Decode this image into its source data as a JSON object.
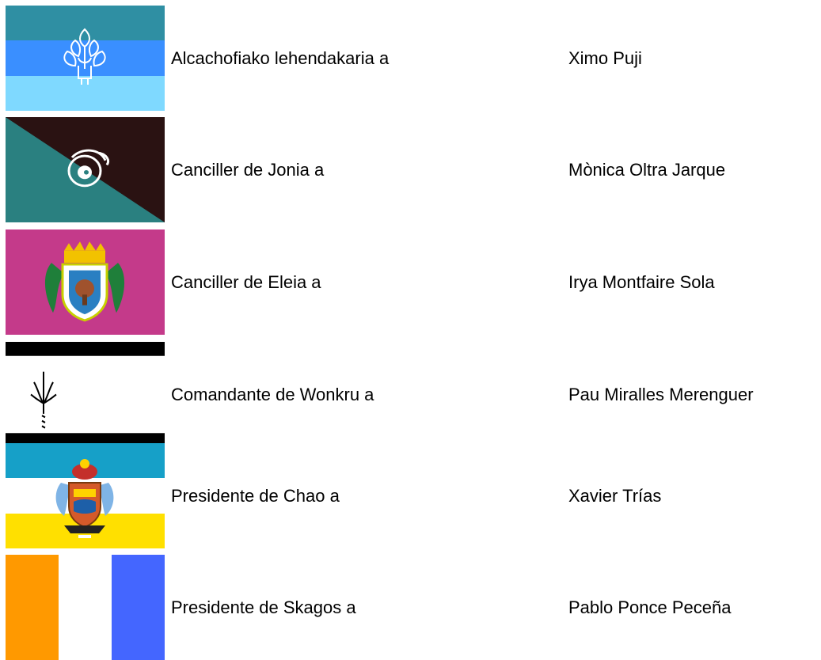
{
  "rows": [
    {
      "title": "Alcachofiako lehendakaria a",
      "person": "Ximo Puji",
      "flag_icon": "artichoke-emblem",
      "flag_colors": [
        "#2f8fa3",
        "#3a8fff",
        "#7fd9ff"
      ]
    },
    {
      "title": "Canciller de Jonia a",
      "person": "Mònica Oltra Jarque",
      "flag_icon": "spiral-emblem",
      "flag_colors": [
        "#2a1212",
        "#2a8080",
        "#ffffff"
      ]
    },
    {
      "title": "Canciller de Eleia a",
      "person": "Irya Montfaire Sola",
      "flag_icon": "coat-of-arms-dragons",
      "flag_colors": [
        "#c43a8a",
        "#f2c200",
        "#2a7fc2",
        "#1f7f3a"
      ]
    },
    {
      "title": "Comandante de Wonkru a",
      "person": "Pau Miralles Merenguer",
      "flag_icon": "trident-emblem",
      "flag_colors": [
        "#000000",
        "#ffffff"
      ]
    },
    {
      "title": "Presidente de Chao a",
      "person": "Xavier Trías",
      "flag_icon": "ornate-coat-of-arms",
      "flag_colors": [
        "#16a0c8",
        "#ffffff",
        "#ffe000"
      ]
    },
    {
      "title": "Presidente de Skagos a",
      "person": "Pablo Ponce Peceña",
      "flag_icon": "tricolor",
      "flag_colors": [
        "#ff9900",
        "#ffffff",
        "#4466ff"
      ]
    }
  ]
}
